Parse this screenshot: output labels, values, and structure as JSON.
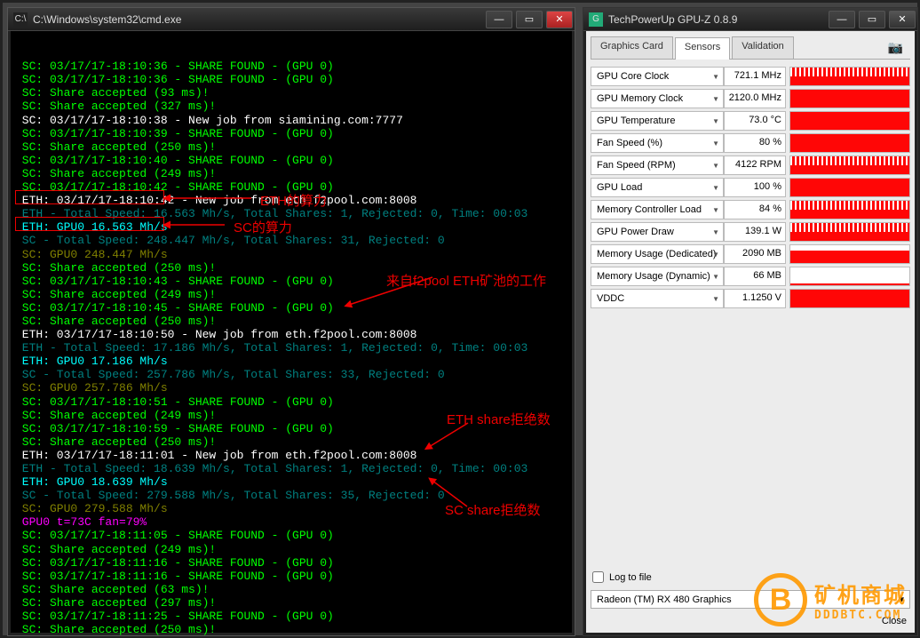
{
  "cmd": {
    "title": "C:\\Windows\\system32\\cmd.exe",
    "lines": [
      {
        "cls": "c-green",
        "txt": "SC: 03/17/17-18:10:36 - SHARE FOUND - (GPU 0)"
      },
      {
        "cls": "c-green",
        "txt": "SC: 03/17/17-18:10:36 - SHARE FOUND - (GPU 0)"
      },
      {
        "cls": "c-green",
        "txt": "SC: Share accepted (93 ms)!"
      },
      {
        "cls": "c-green",
        "txt": "SC: Share accepted (327 ms)!"
      },
      {
        "cls": "c-white",
        "txt": "SC: 03/17/17-18:10:38 - New job from siamining.com:7777"
      },
      {
        "cls": "c-green",
        "txt": "SC: 03/17/17-18:10:39 - SHARE FOUND - (GPU 0)"
      },
      {
        "cls": "c-green",
        "txt": "SC: Share accepted (250 ms)!"
      },
      {
        "cls": "c-green",
        "txt": "SC: 03/17/17-18:10:40 - SHARE FOUND - (GPU 0)"
      },
      {
        "cls": "c-green",
        "txt": "SC: Share accepted (249 ms)!"
      },
      {
        "cls": "c-green",
        "txt": "SC: 03/17/17-18:10:42 - SHARE FOUND - (GPU 0)"
      },
      {
        "cls": "c-white",
        "txt": "ETH: 03/17/17-18:10:42 - New job from eth.f2pool.com:8008"
      },
      {
        "cls": "c-teal",
        "txt": "ETH - Total Speed: 16.563 Mh/s, Total Shares: 1, Rejected: 0, Time: 00:03"
      },
      {
        "cls": "c-cyan",
        "txt": "ETH: GPU0 16.563 Mh/s"
      },
      {
        "cls": "c-teal",
        "txt": "SC - Total Speed: 248.447 Mh/s, Total Shares: 31, Rejected: 0"
      },
      {
        "cls": "c-olive",
        "txt": "SC: GPU0 248.447 Mh/s"
      },
      {
        "cls": "c-green",
        "txt": "SC: Share accepted (250 ms)!"
      },
      {
        "cls": "c-green",
        "txt": "SC: 03/17/17-18:10:43 - SHARE FOUND - (GPU 0)"
      },
      {
        "cls": "c-green",
        "txt": "SC: Share accepted (249 ms)!"
      },
      {
        "cls": "c-green",
        "txt": "SC: 03/17/17-18:10:45 - SHARE FOUND - (GPU 0)"
      },
      {
        "cls": "c-green",
        "txt": "SC: Share accepted (250 ms)!"
      },
      {
        "cls": "c-white",
        "txt": "ETH: 03/17/17-18:10:50 - New job from eth.f2pool.com:8008"
      },
      {
        "cls": "c-teal",
        "txt": "ETH - Total Speed: 17.186 Mh/s, Total Shares: 1, Rejected: 0, Time: 00:03"
      },
      {
        "cls": "c-cyan",
        "txt": "ETH: GPU0 17.186 Mh/s"
      },
      {
        "cls": "c-teal",
        "txt": "SC - Total Speed: 257.786 Mh/s, Total Shares: 33, Rejected: 0"
      },
      {
        "cls": "c-olive",
        "txt": "SC: GPU0 257.786 Mh/s"
      },
      {
        "cls": "c-green",
        "txt": "SC: 03/17/17-18:10:51 - SHARE FOUND - (GPU 0)"
      },
      {
        "cls": "c-green",
        "txt": "SC: Share accepted (249 ms)!"
      },
      {
        "cls": "c-green",
        "txt": "SC: 03/17/17-18:10:59 - SHARE FOUND - (GPU 0)"
      },
      {
        "cls": "c-green",
        "txt": "SC: Share accepted (250 ms)!"
      },
      {
        "cls": "c-white",
        "txt": "ETH: 03/17/17-18:11:01 - New job from eth.f2pool.com:8008"
      },
      {
        "cls": "c-teal",
        "txt": "ETH - Total Speed: 18.639 Mh/s, Total Shares: 1, Rejected: 0, Time: 00:03"
      },
      {
        "cls": "c-cyan",
        "txt": "ETH: GPU0 18.639 Mh/s"
      },
      {
        "cls": "c-teal",
        "txt": "SC - Total Speed: 279.588 Mh/s, Total Shares: 35, Rejected: 0"
      },
      {
        "cls": "c-olive",
        "txt": "SC: GPU0 279.588 Mh/s"
      },
      {
        "cls": "c-purple",
        "txt": "GPU0 t=73C fan=79%"
      },
      {
        "cls": "c-green",
        "txt": "SC: 03/17/17-18:11:05 - SHARE FOUND - (GPU 0)"
      },
      {
        "cls": "c-green",
        "txt": "SC: Share accepted (249 ms)!"
      },
      {
        "cls": "c-green",
        "txt": "SC: 03/17/17-18:11:16 - SHARE FOUND - (GPU 0)"
      },
      {
        "cls": "c-green",
        "txt": "SC: 03/17/17-18:11:16 - SHARE FOUND - (GPU 0)"
      },
      {
        "cls": "c-green",
        "txt": "SC: Share accepted (63 ms)!"
      },
      {
        "cls": "c-green",
        "txt": "SC: Share accepted (297 ms)!"
      },
      {
        "cls": "c-green",
        "txt": "SC: 03/17/17-18:11:25 - SHARE FOUND - (GPU 0)"
      },
      {
        "cls": "c-green",
        "txt": "SC: Share accepted (250 ms)!"
      }
    ]
  },
  "gpuz": {
    "title": "TechPowerUp GPU-Z 0.8.9",
    "tabs": [
      "Graphics Card",
      "Sensors",
      "Validation"
    ],
    "sensors": [
      {
        "label": "GPU Core Clock",
        "value": "721.1 MHz",
        "graph": "noisy"
      },
      {
        "label": "GPU Memory Clock",
        "value": "2120.0 MHz",
        "graph": "full"
      },
      {
        "label": "GPU Temperature",
        "value": "73.0 °C",
        "graph": "full"
      },
      {
        "label": "Fan Speed (%)",
        "value": "80 %",
        "graph": "full"
      },
      {
        "label": "Fan Speed (RPM)",
        "value": "4122 RPM",
        "graph": "noisy"
      },
      {
        "label": "GPU Load",
        "value": "100 %",
        "graph": "full"
      },
      {
        "label": "Memory Controller Load",
        "value": "84 %",
        "graph": "noisy"
      },
      {
        "label": "GPU Power Draw",
        "value": "139.1 W",
        "graph": "noisy"
      },
      {
        "label": "Memory Usage (Dedicated)",
        "value": "2090 MB",
        "graph": "partial"
      },
      {
        "label": "Memory Usage (Dynamic)",
        "value": "66 MB",
        "graph": "small"
      },
      {
        "label": "VDDC",
        "value": "1.1250 V",
        "graph": "full"
      }
    ],
    "log_to_file": "Log to file",
    "gpu_name": "Radeon (TM) RX 480 Graphics",
    "close": "Close"
  },
  "annotations": {
    "eth_hash": "ETH的算力",
    "sc_hash": "SC的算力",
    "f2pool_job": "来自f2pool ETH矿池的工作",
    "eth_rejected": "ETH share拒绝数",
    "sc_rejected": "SC share拒绝数"
  },
  "watermark": {
    "cn": "矿机商城",
    "en": "DDDBTC.COM"
  }
}
